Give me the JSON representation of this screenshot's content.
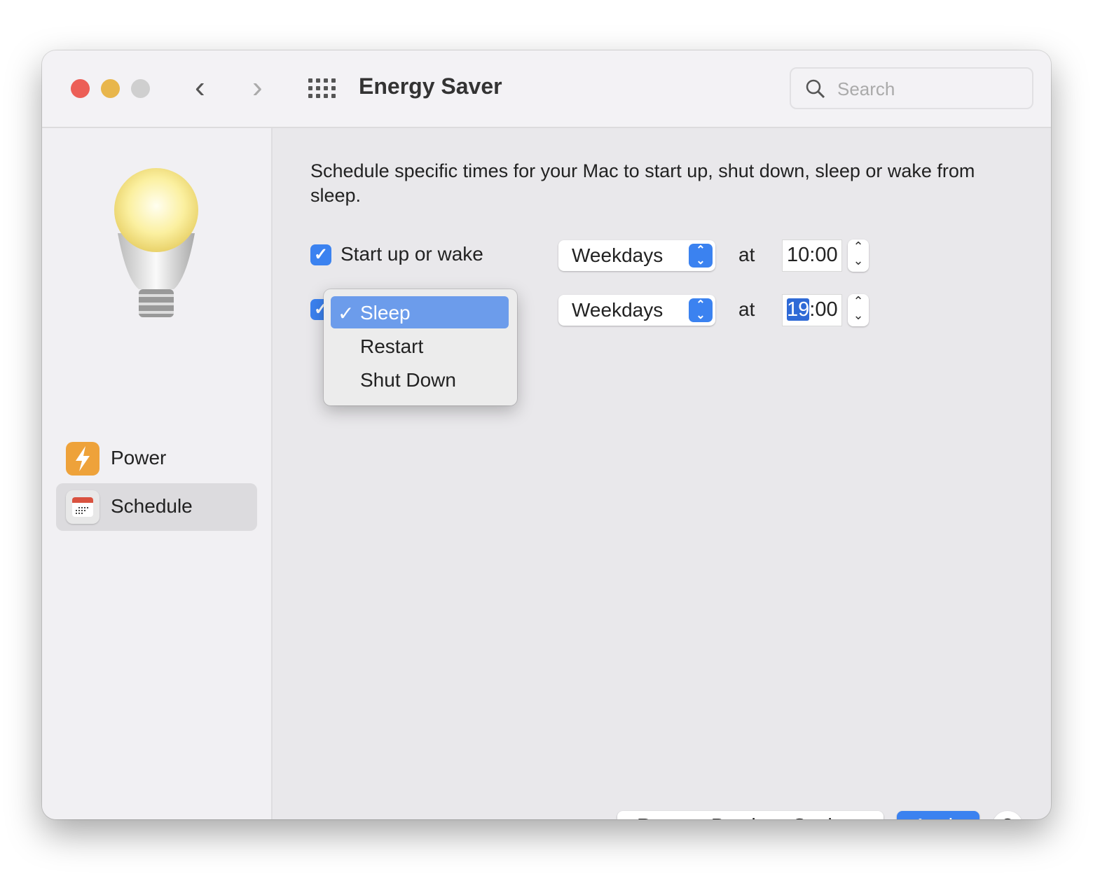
{
  "window": {
    "title": "Energy Saver",
    "search_placeholder": "Search"
  },
  "colors": {
    "accent": "#3b82f0",
    "close": "#ec5f57",
    "minimize": "#e8b64c",
    "zoom": "#cfcfcf"
  },
  "sidebar": {
    "items": [
      {
        "label": "Power",
        "icon": "lightning-icon",
        "selected": false
      },
      {
        "label": "Schedule",
        "icon": "calendar-icon",
        "selected": true
      }
    ]
  },
  "main": {
    "description": "Schedule specific times for your Mac to start up, shut down, sleep or wake from sleep.",
    "rows": [
      {
        "checked": true,
        "label": "Start up or wake",
        "days": "Weekdays",
        "at": "at",
        "hour": "10",
        "minute": "00"
      },
      {
        "checked": true,
        "days": "Weekdays",
        "at": "at",
        "hour": "19",
        "minute": "00"
      }
    ],
    "action_menu": {
      "options": [
        "Sleep",
        "Restart",
        "Shut Down"
      ],
      "selected": "Sleep",
      "checkmark": "✓"
    },
    "buttons": {
      "restore": "Restore Previous Settings",
      "apply": "Apply",
      "help": "?"
    }
  }
}
